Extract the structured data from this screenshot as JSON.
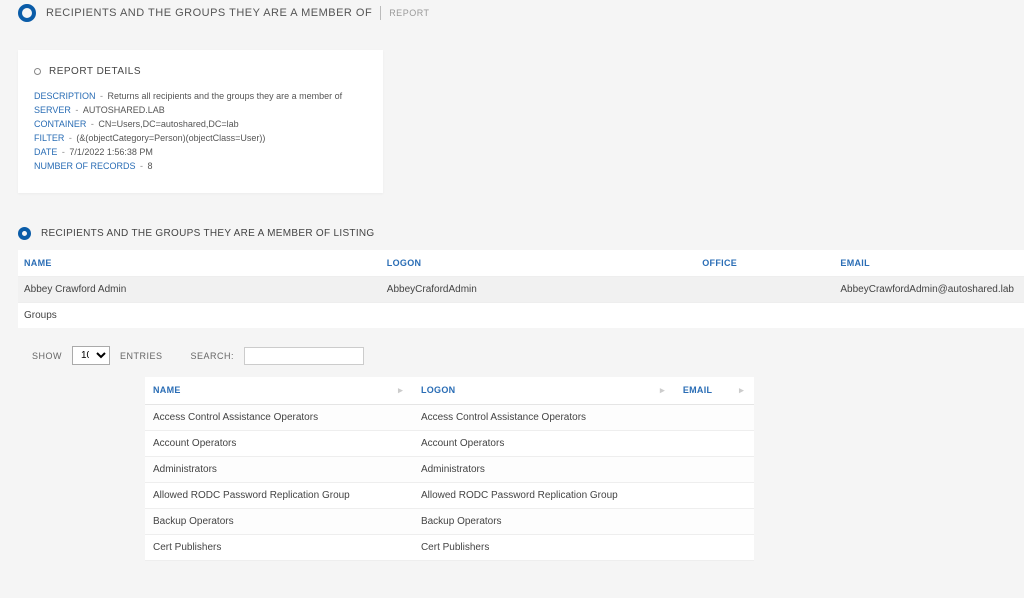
{
  "header": {
    "title": "RECIPIENTS AND THE GROUPS THEY ARE A MEMBER OF",
    "tag": "REPORT"
  },
  "details": {
    "card_title": "REPORT DETAILS",
    "labels": {
      "description": "DESCRIPTION",
      "server": "SERVER",
      "container": "CONTAINER",
      "filter": "FILTER",
      "date": "DATE",
      "records": "NUMBER OF RECORDS"
    },
    "values": {
      "description": "Returns all recipients and the groups they are a member of",
      "server": "AUTOSHARED.LAB",
      "container": "CN=Users,DC=autoshared,DC=lab",
      "filter": "(&(objectCategory=Person)(objectClass=User))",
      "date": "7/1/2022 1:56:38 PM",
      "records": "8"
    }
  },
  "listing": {
    "section_title": "RECIPIENTS AND THE GROUPS THEY ARE A MEMBER OF LISTING",
    "columns": {
      "name": "NAME",
      "logon": "LOGON",
      "office": "OFFICE",
      "email": "EMAIL"
    },
    "row": {
      "name": "Abbey Crawford Admin",
      "logon": "AbbeyCrafordAdmin",
      "office": "",
      "email": "AbbeyCrawfordAdmin@autoshared.lab"
    },
    "groups_label": "Groups"
  },
  "controls": {
    "show": "SHOW",
    "entries": "ENTRIES",
    "search": "SEARCH:",
    "page_size": "10"
  },
  "groups_table": {
    "columns": {
      "name": "NAME",
      "logon": "LOGON",
      "email": "EMAIL"
    },
    "rows": [
      {
        "name": "Access Control Assistance Operators",
        "logon": "Access Control Assistance Operators",
        "email": ""
      },
      {
        "name": "Account Operators",
        "logon": "Account Operators",
        "email": ""
      },
      {
        "name": "Administrators",
        "logon": "Administrators",
        "email": ""
      },
      {
        "name": "Allowed RODC Password Replication Group",
        "logon": "Allowed RODC Password Replication Group",
        "email": ""
      },
      {
        "name": "Backup Operators",
        "logon": "Backup Operators",
        "email": ""
      },
      {
        "name": "Cert Publishers",
        "logon": "Cert Publishers",
        "email": ""
      }
    ]
  }
}
